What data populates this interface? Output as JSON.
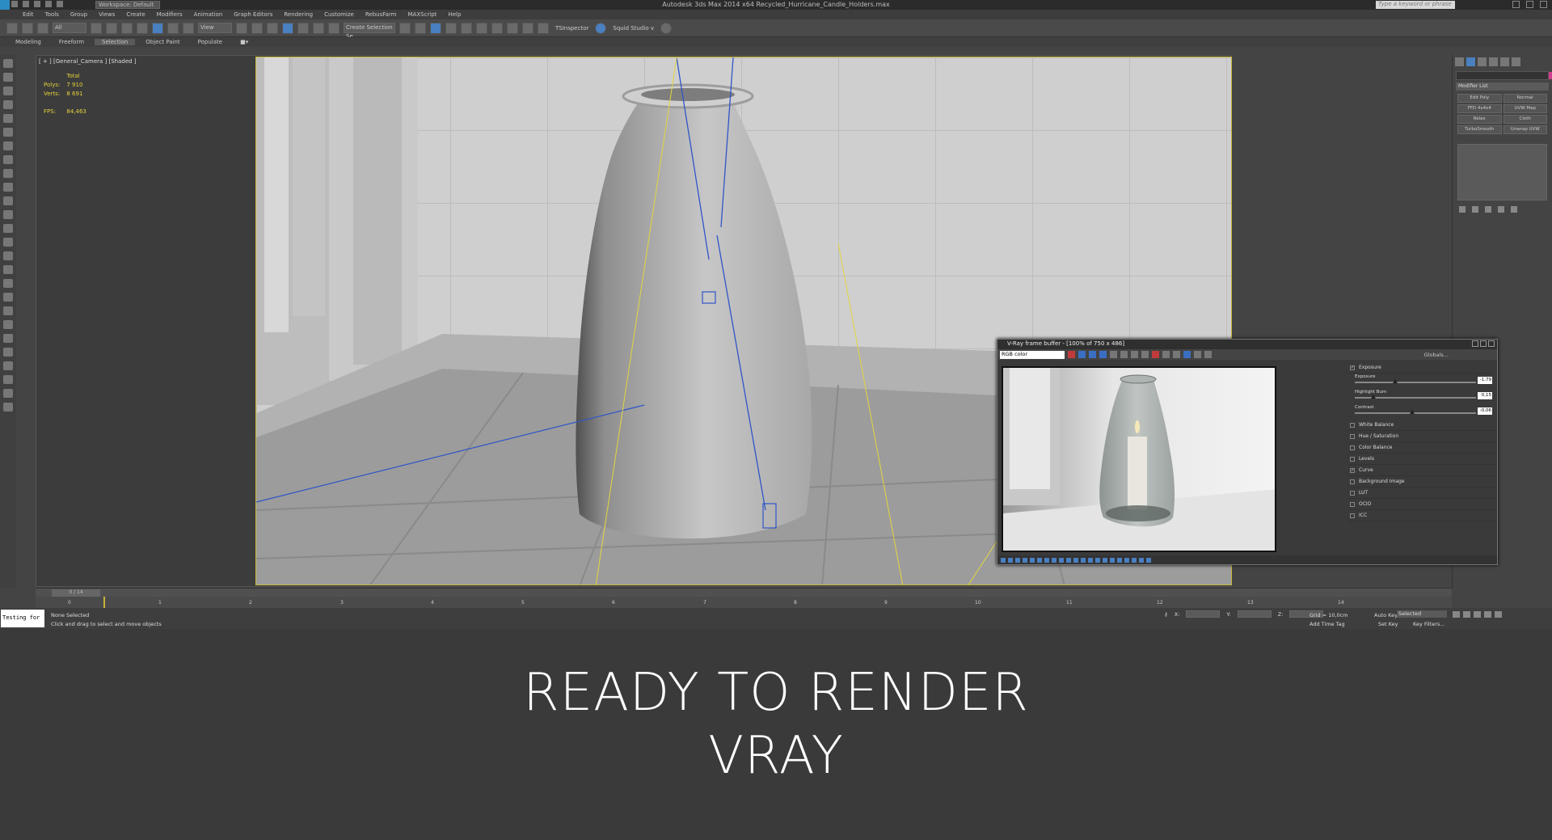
{
  "titlebar": {
    "title": "Autodesk 3ds Max  2014 x64     Recycled_Hurricane_Candle_Holders.max",
    "workspace": "Workspace: Default",
    "search_placeholder": "Type a keyword or phrase"
  },
  "menus": [
    "Edit",
    "Tools",
    "Group",
    "Views",
    "Create",
    "Modifiers",
    "Animation",
    "Graph Editors",
    "Rendering",
    "Customize",
    "RebusFarm",
    "MAXScript",
    "Help"
  ],
  "toolbar": {
    "filter": "All",
    "view": "View",
    "selection_set": "Create Selection Se",
    "tsinspector": "TSInspector",
    "squid": "Squid Studio v"
  },
  "ribbon_tabs": [
    "Modeling",
    "Freeform",
    "Selection",
    "Object Paint",
    "Populate"
  ],
  "ribbon_active": "Selection",
  "viewport": {
    "label": "[ + ] [General_Camera ] [Shaded ]",
    "stats": {
      "header": "Total",
      "polys_label": "Polys:",
      "polys": "7 910",
      "verts_label": "Verts:",
      "verts": "8 691",
      "fps_label": "FPS:",
      "fps": "84,463"
    }
  },
  "command_panel": {
    "modifier_list": "Modifier List",
    "buttons": [
      "Edit Poly",
      "Normal",
      "FFD 4x4x4",
      "UVW Map",
      "Relax",
      "Cloth",
      "TurboSmooth",
      "Unwrap UVW"
    ]
  },
  "timeline": {
    "frame_slider": "0 / 14",
    "ticks": [
      "0",
      "1",
      "2",
      "3",
      "4",
      "5",
      "6",
      "7",
      "8",
      "9",
      "10",
      "11",
      "12",
      "13",
      "14"
    ]
  },
  "status": {
    "mini_listener": "Testing for",
    "selection": "None Selected",
    "prompt": "Click and drag to select and move objects",
    "x_label": "X:",
    "y_label": "Y:",
    "z_label": "Z:",
    "grid": "Grid = 10,0cm",
    "add_time_tag": "Add Time Tag",
    "auto_key": "Auto Key",
    "selected": "Selected",
    "set_key": "Set Key",
    "key_filters": "Key Filters...",
    "frame": "0"
  },
  "vfb": {
    "title": "V-Ray frame buffer - [100% of 750 x 486]",
    "channel": "RGB color",
    "globals": "Globals...",
    "exposure": "Exposure",
    "sliders": [
      {
        "label": "Exposure",
        "value": "-1,79",
        "level": 0.33
      },
      {
        "label": "Highlight Burn",
        "value": "0,15",
        "level": 0.15
      },
      {
        "label": "Contrast",
        "value": "-0,06",
        "level": 0.47
      }
    ],
    "layers": [
      {
        "label": "White Balance",
        "checked": false
      },
      {
        "label": "Hue / Saturation",
        "checked": false
      },
      {
        "label": "Color Balance",
        "checked": false
      },
      {
        "label": "Levels",
        "checked": false
      },
      {
        "label": "Curve",
        "checked": true
      },
      {
        "label": "Background Image",
        "checked": false
      },
      {
        "label": "LUT",
        "checked": false
      },
      {
        "label": "OCIO",
        "checked": false
      },
      {
        "label": "ICC",
        "checked": false
      }
    ]
  },
  "caption": {
    "line1": "READY TO RENDER",
    "line2": "VRAY"
  },
  "colors": {
    "accent_blue": "#4a7fc0",
    "viewport_frame": "#c8bb3a",
    "stats_yellow": "#e6d23a",
    "object_color": "#d23e8f"
  }
}
